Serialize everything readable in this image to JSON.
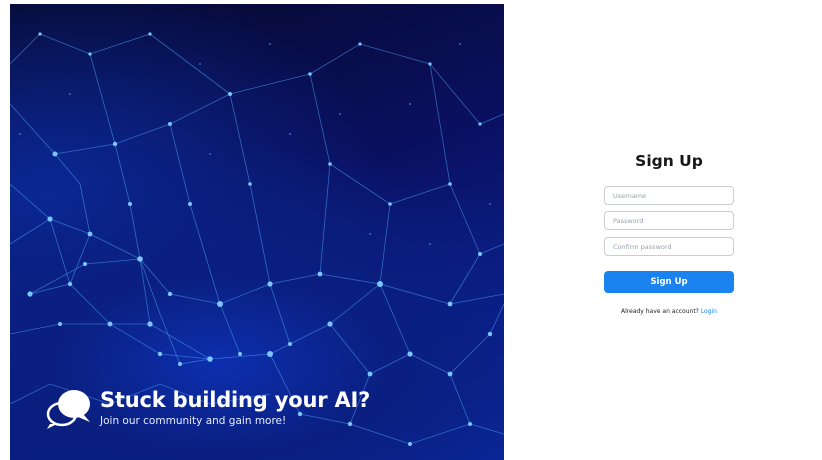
{
  "hero": {
    "title": "Stuck building your AI?",
    "subtitle": "Join our community and gain more!",
    "icon": "chat-bubbles-icon"
  },
  "form": {
    "title": "Sign Up",
    "username_placeholder": "Username",
    "password_placeholder": "Password",
    "confirm_placeholder": "Confirm password",
    "submit_label": "Sign Up",
    "login_prompt": "Already have an account?",
    "login_link": "Login"
  },
  "colors": {
    "accent": "#1a83f0",
    "hero_bg_dark": "#06082a",
    "hero_bg_blue": "#0b1f8a",
    "network_line": "#4fa8ff"
  }
}
